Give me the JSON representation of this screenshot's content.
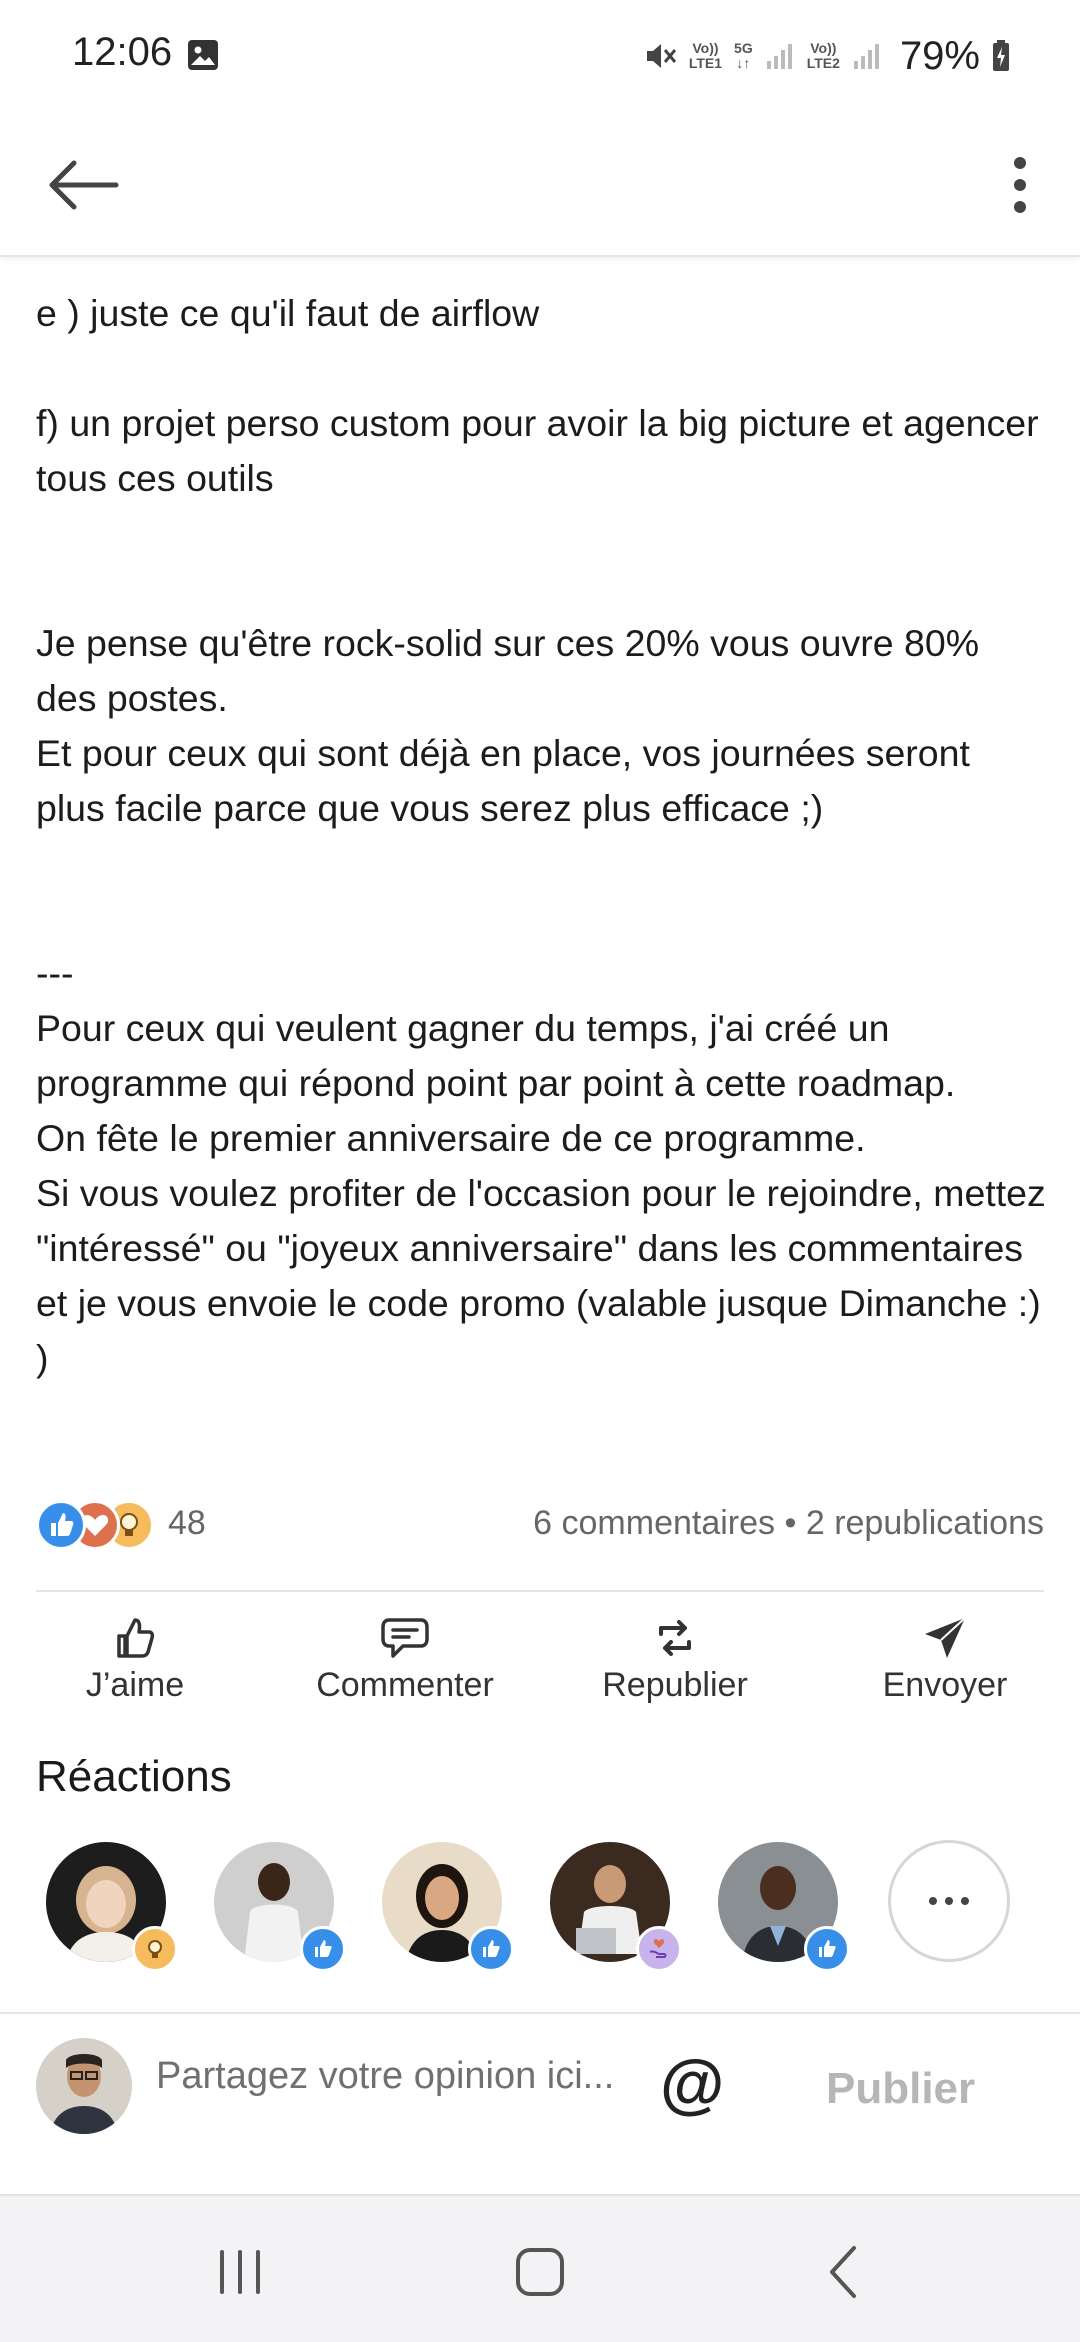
{
  "status_bar": {
    "time": "12:06",
    "sim1_label_top": "Vo))",
    "sim1_label_bottom": "LTE1",
    "network_label": "5G",
    "sim2_label_top": "Vo))",
    "sim2_label_bottom": "LTE2",
    "battery": "79%"
  },
  "post": {
    "paragraphs": [
      "e ) juste ce qu'il faut de airflow\n\nf) un projet perso custom pour avoir la big picture et agencer tous ces outils\n\n\n",
      "Je pense qu'être rock-solid sur ces 20% vous ouvre 80% des postes.\nEt pour ceux qui sont déjà en place, vos journées seront plus facile parce que vous serez plus efficace ;)\n\n\n",
      "---\nPour ceux qui veulent gagner du temps, j'ai créé un programme qui répond point par point à cette roadmap.\nOn fête le premier anniversaire de ce programme.\nSi vous voulez profiter de l'occasion pour le rejoindre, mettez \"intéressé\" ou \"joyeux anniversaire\" dans les commentaires et je vous envoie le code promo (valable jusque Dimanche :) )"
    ]
  },
  "social": {
    "reaction_count": "48",
    "engagement": "6 commentaires • 2 republications"
  },
  "actions": {
    "like": "J’aime",
    "comment": "Commenter",
    "repost": "Republier",
    "send": "Envoyer"
  },
  "reactions": {
    "title": "Réactions"
  },
  "composer": {
    "placeholder": "Partagez votre opinion ici...",
    "mention": "@",
    "publish": "Publier"
  },
  "colors": {
    "like_blue": "#378fe9",
    "love_red": "#df704d",
    "insight_yellow": "#f5bb5c",
    "support_purple": "#a872e8"
  }
}
